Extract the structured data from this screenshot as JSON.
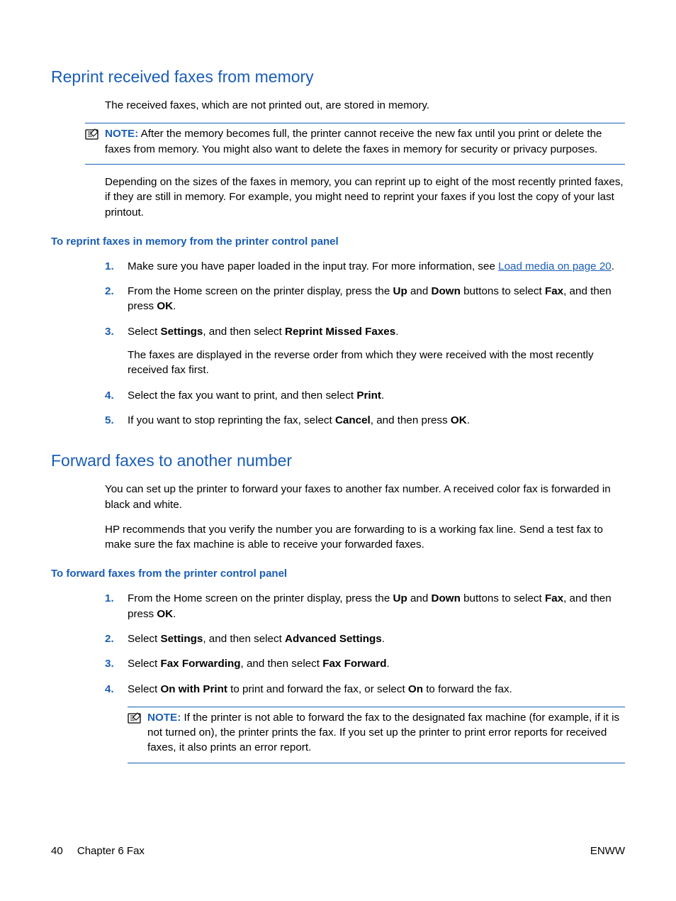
{
  "section1": {
    "title": "Reprint received faxes from memory",
    "p1": "The received faxes, which are not printed out, are stored in memory.",
    "note_label": "NOTE:",
    "note_text": "After the memory becomes full, the printer cannot receive the new fax until you print or delete the faxes from memory. You might also want to delete the faxes in memory for security or privacy purposes.",
    "p2": "Depending on the sizes of the faxes in memory, you can reprint up to eight of the most recently printed faxes, if they are still in memory. For example, you might need to reprint your faxes if you lost the copy of your last printout.",
    "sub": "To reprint faxes in memory from the printer control panel",
    "step1_pre": "Make sure you have paper loaded in the input tray. For more information, see ",
    "step1_link": "Load media on page 20",
    "step1_post": ".",
    "step2_a": "From the Home screen on the printer display, press the ",
    "step2_up": "Up",
    "step2_b": " and ",
    "step2_down": "Down",
    "step2_c": " buttons to select ",
    "step2_fax": "Fax",
    "step2_d": ", and then press ",
    "step2_ok": "OK",
    "step2_e": ".",
    "step3_a": "Select ",
    "step3_settings": "Settings",
    "step3_b": ", and then select ",
    "step3_rmf": "Reprint Missed Faxes",
    "step3_c": ".",
    "step3_p2": "The faxes are displayed in the reverse order from which they were received with the most recently received fax first.",
    "step4_a": "Select the fax you want to print, and then select ",
    "step4_print": "Print",
    "step4_b": ".",
    "step5_a": "If you want to stop reprinting the fax, select ",
    "step5_cancel": "Cancel",
    "step5_b": ", and then press ",
    "step5_ok": "OK",
    "step5_c": "."
  },
  "section2": {
    "title": "Forward faxes to another number",
    "p1": "You can set up the printer to forward your faxes to another fax number. A received color fax is forwarded in black and white.",
    "p2": "HP recommends that you verify the number you are forwarding to is a working fax line. Send a test fax to make sure the fax machine is able to receive your forwarded faxes.",
    "sub": "To forward faxes from the printer control panel",
    "step1_a": "From the Home screen on the printer display, press the ",
    "step1_up": "Up",
    "step1_b": " and ",
    "step1_down": "Down",
    "step1_c": " buttons to select ",
    "step1_fax": "Fax",
    "step1_d": ", and then press ",
    "step1_ok": "OK",
    "step1_e": ".",
    "step2_a": "Select ",
    "step2_settings": "Settings",
    "step2_b": ", and then select ",
    "step2_adv": "Advanced Settings",
    "step2_c": ".",
    "step3_a": "Select ",
    "step3_ff": "Fax Forwarding",
    "step3_b": ", and then select ",
    "step3_fw": "Fax Forward",
    "step3_c": ".",
    "step4_a": "Select ",
    "step4_owp": "On with Print",
    "step4_b": " to print and forward the fax, or select ",
    "step4_on": "On",
    "step4_c": " to forward the fax.",
    "note_label": "NOTE:",
    "note_text": "If the printer is not able to forward the fax to the designated fax machine (for example, if it is not turned on), the printer prints the fax. If you set up the printer to print error reports for received faxes, it also prints an error report."
  },
  "footer": {
    "page": "40",
    "chapter": "Chapter 6   Fax",
    "right": "ENWW"
  },
  "nums": {
    "n1": "1.",
    "n2": "2.",
    "n3": "3.",
    "n4": "4.",
    "n5": "5."
  }
}
